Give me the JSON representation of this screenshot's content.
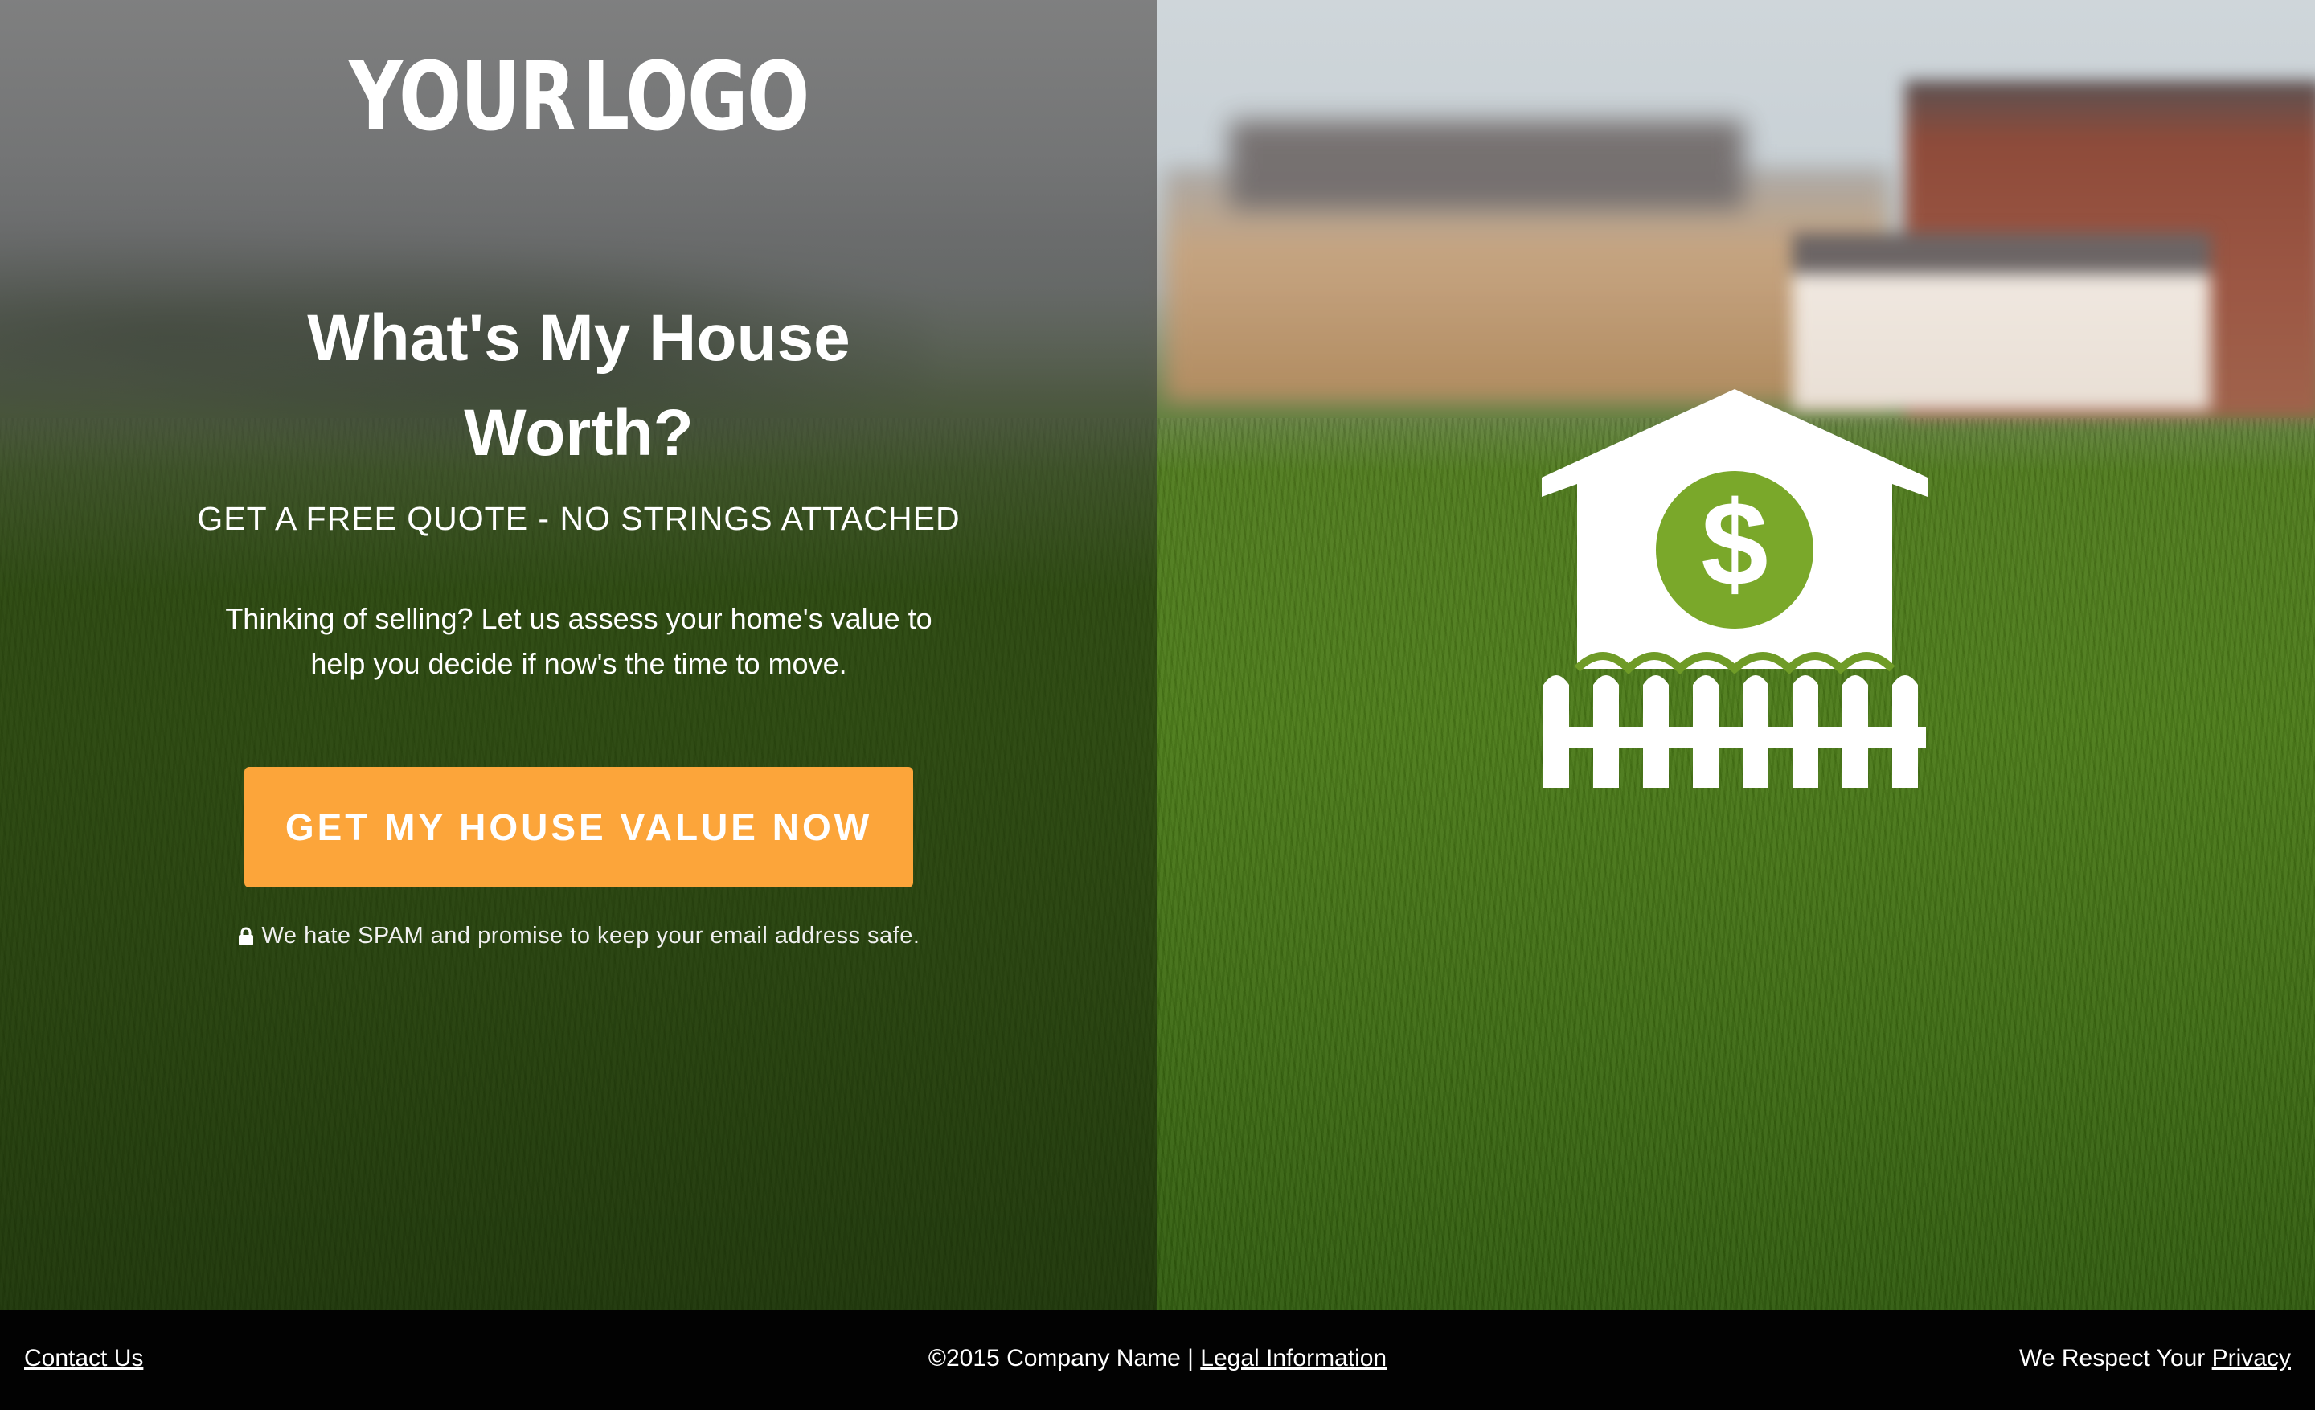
{
  "logo": {
    "left_text": "YOUR",
    "right_text": "LOGO"
  },
  "hero": {
    "headline_line1": "What's My House",
    "headline_line2": "Worth?",
    "subheadline": "GET A FREE QUOTE - NO STRINGS ATTACHED",
    "body_line1": "Thinking of selling? Let us assess your home's value to",
    "body_line2": "help you decide if now's the time to move.",
    "cta_label": "GET MY HOUSE VALUE NOW",
    "spam_note": "We hate SPAM and promise to keep your email address safe."
  },
  "illustration": {
    "symbol": "$"
  },
  "footer": {
    "contact_label": "Contact Us",
    "copyright": "©2015 Company Name | ",
    "legal_label": "Legal Information",
    "privacy_prefix": "We Respect Your ",
    "privacy_label": "Privacy"
  },
  "colors": {
    "cta": "#fca53a",
    "footer_bg": "#020202",
    "icon": "#ffffff"
  }
}
